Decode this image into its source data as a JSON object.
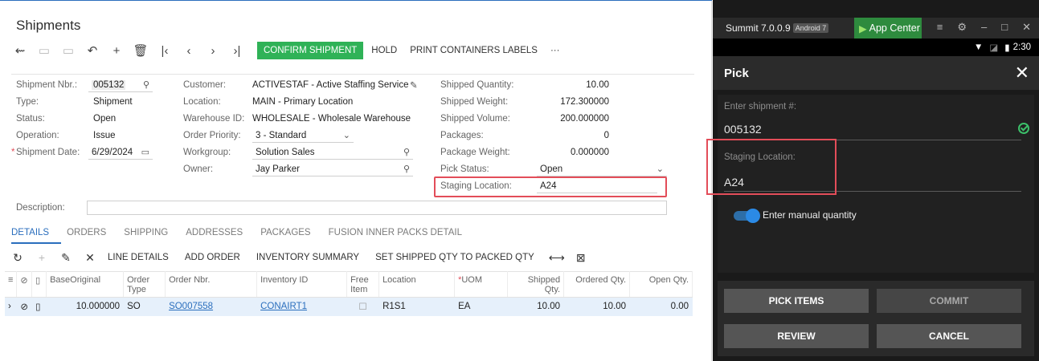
{
  "erp": {
    "title": "Shipments",
    "toolbar": {
      "confirm_label": "CONFIRM SHIPMENT",
      "hold_label": "HOLD",
      "print_label": "PRINT CONTAINERS LABELS",
      "more_label": "···"
    },
    "form": {
      "shipment_nbr_label": "Shipment Nbr.:",
      "shipment_nbr": "005132",
      "type_label": "Type:",
      "type": "Shipment",
      "status_label": "Status:",
      "status": "Open",
      "operation_label": "Operation:",
      "operation": "Issue",
      "shipment_date_label": "Shipment Date:",
      "shipment_date": "6/29/2024",
      "customer_label": "Customer:",
      "customer": "ACTIVESTAF - Active Staffing Service",
      "location_label": "Location:",
      "location": "MAIN - Primary Location",
      "warehouse_label": "Warehouse ID:",
      "warehouse": "WHOLESALE - Wholesale Warehouse",
      "priority_label": "Order Priority:",
      "priority": "3 - Standard",
      "workgroup_label": "Workgroup:",
      "workgroup": "Solution Sales",
      "owner_label": "Owner:",
      "owner": "Jay Parker",
      "shipped_qty_label": "Shipped Quantity:",
      "shipped_qty": "10.00",
      "shipped_weight_label": "Shipped Weight:",
      "shipped_weight": "172.300000",
      "shipped_volume_label": "Shipped Volume:",
      "shipped_volume": "200.000000",
      "packages_label": "Packages:",
      "packages": "0",
      "package_weight_label": "Package Weight:",
      "package_weight": "0.000000",
      "pick_status_label": "Pick Status:",
      "pick_status": "Open",
      "staging_label": "Staging Location:",
      "staging": "A24",
      "description_label": "Description:",
      "description": ""
    },
    "tabs": [
      "DETAILS",
      "ORDERS",
      "SHIPPING",
      "ADDRESSES",
      "PACKAGES",
      "FUSION INNER PACKS DETAIL"
    ],
    "grid_toolbar": {
      "line_details": "LINE DETAILS",
      "add_order": "ADD ORDER",
      "inventory_summary": "INVENTORY SUMMARY",
      "set_shipped": "SET SHIPPED QTY TO PACKED QTY"
    },
    "grid": {
      "headers": {
        "base_original": "BaseOriginal",
        "order_type": "Order Type",
        "order_nbr": "Order Nbr.",
        "inventory_id": "Inventory ID",
        "free_item": "Free Item",
        "location": "Location",
        "uom": "UOM",
        "shipped_qty": "Shipped Qty.",
        "ordered_qty": "Ordered Qty.",
        "open_qty": "Open Qty."
      },
      "rows": [
        {
          "base_original": "10.000000",
          "order_type": "SO",
          "order_nbr": "SO007558",
          "inventory_id": "CONAIRT1",
          "location": "R1S1",
          "uom": "EA",
          "shipped_qty": "10.00",
          "ordered_qty": "10.00",
          "open_qty": "0.00"
        }
      ]
    }
  },
  "phone": {
    "emulator_title": "Summit 7.0.0.9",
    "emulator_badge": "Android 7",
    "app_center": "App Center",
    "clock": "2:30",
    "screen_title": "Pick",
    "shipment_label": "Enter shipment #:",
    "shipment_value": "005132",
    "staging_label": "Staging Location:",
    "staging_value": "A24",
    "toggle_label": "Enter manual quantity",
    "buttons": {
      "pick_items": "PICK ITEMS",
      "commit": "COMMIT",
      "review": "REVIEW",
      "cancel": "CANCEL"
    }
  },
  "colors": {
    "accent_blue": "#2a6ebd",
    "confirm_green": "#2fb257",
    "highlight_red": "#e34d59",
    "app_center_green": "#2e8b3e"
  }
}
